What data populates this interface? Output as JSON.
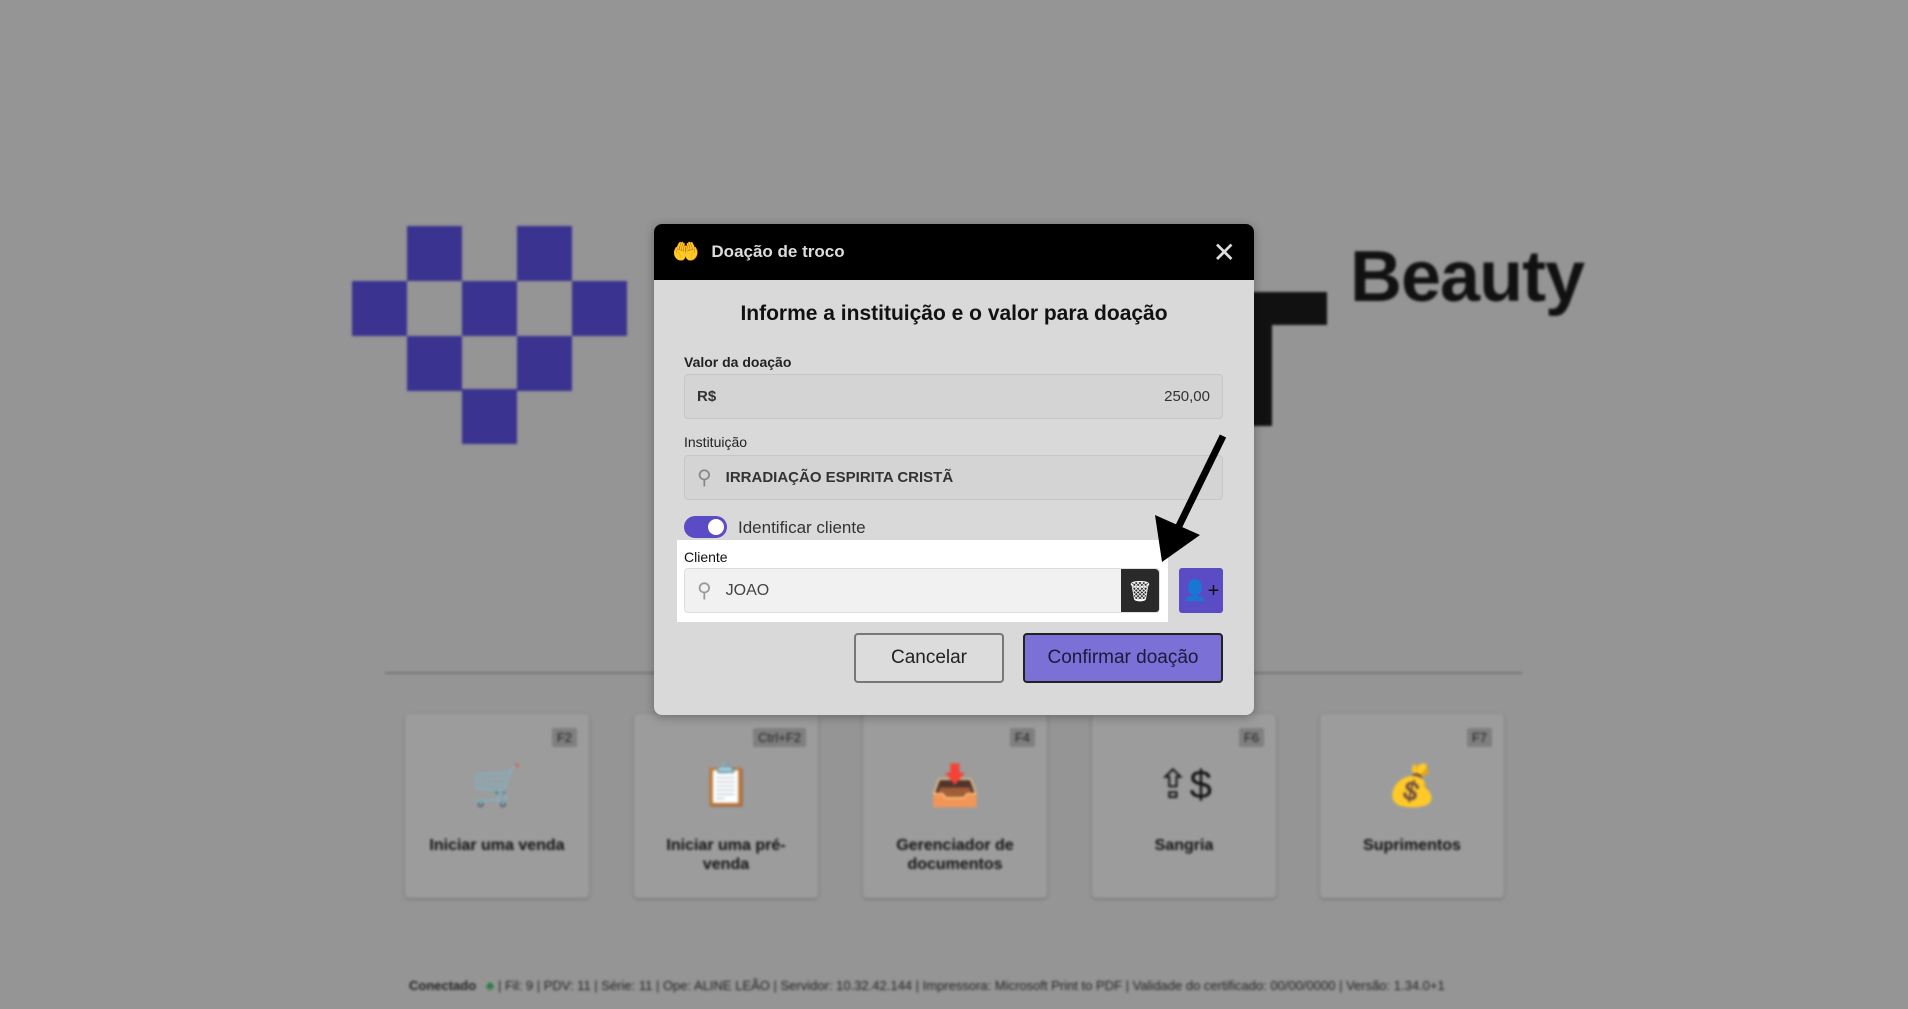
{
  "brand": {
    "name": "Beauty",
    "color": "#3a3390"
  },
  "shortcuts": [
    {
      "key": "F2",
      "label": "Iniciar uma venda",
      "icon": "cart-icon"
    },
    {
      "key": "Ctrl+F2",
      "label": "Iniciar uma pré-venda",
      "icon": "clipboard-icon"
    },
    {
      "key": "F4",
      "label": "Gerenciador de documentos",
      "icon": "inbox-icon"
    },
    {
      "key": "F6",
      "label": "Sangria",
      "icon": "cash-out-icon"
    },
    {
      "key": "F7",
      "label": "Suprimentos",
      "icon": "money-bag-icon"
    }
  ],
  "footer": {
    "status": "Conectado",
    "info": "| Fil: 9 | PDV: 11 | Série: 11 | Ope: ALINE LEÃO | Servidor: 10.32.42.144 | Impressora: Microsoft Print to PDF | Validade do certificado: 00/00/0000 | Versão: 1.34.0+1"
  },
  "dialog": {
    "title": "Doação de troco",
    "heading": "Informe a instituição e o valor para doação",
    "valor_label": "Valor da doação",
    "currency": "R$",
    "valor": "250,00",
    "instituicao_label": "Instituição",
    "instituicao": "IRRADIAÇÃO ESPIRITA CRISTÃ",
    "toggle_label": "Identificar cliente",
    "toggle_on": true,
    "cliente_label": "Cliente",
    "cliente": "JOAO",
    "cancel": "Cancelar",
    "confirm": "Confirmar doação",
    "accent": "#5a4cc4"
  }
}
